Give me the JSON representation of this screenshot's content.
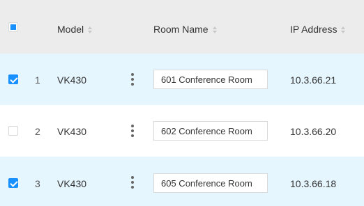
{
  "header": {
    "model_label": "Model",
    "room_name_label": "Room Name",
    "ip_address_label": "IP Address"
  },
  "rows": [
    {
      "selected": true,
      "index": "1",
      "model": "VK430",
      "room_name": "601 Conference Room",
      "ip": "10.3.66.21"
    },
    {
      "selected": false,
      "index": "2",
      "model": "VK430",
      "room_name": "602 Conference Room",
      "ip": "10.3.66.20"
    },
    {
      "selected": true,
      "index": "3",
      "model": "VK430",
      "room_name": "605 Conference Room",
      "ip": "10.3.66.18"
    }
  ],
  "colors": {
    "selected_row_bg": "#e6f6ff",
    "header_bg": "#ececec",
    "accent": "#1890ff"
  },
  "icons": {
    "header_checkbox": "indeterminate-checkbox-icon",
    "row_menu": "more-vertical-icon",
    "sort": "sort-icon"
  }
}
